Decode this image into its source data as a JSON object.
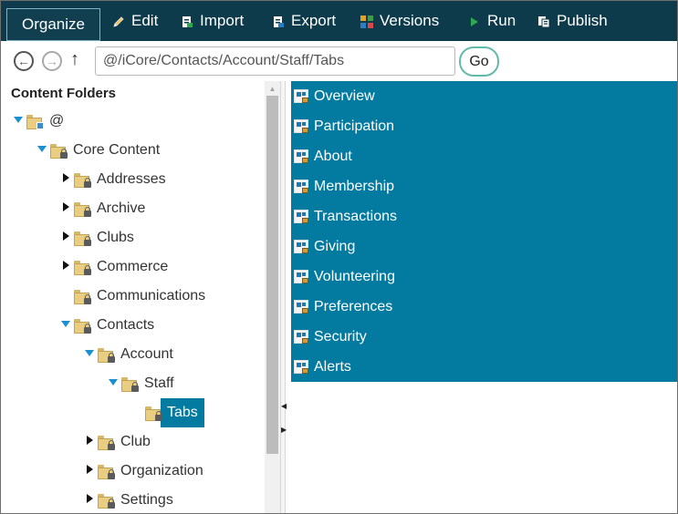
{
  "toolbar": {
    "buttons": [
      {
        "label": "Organize",
        "icon": "none"
      },
      {
        "label": "Edit",
        "icon": "pencil-icon"
      },
      {
        "label": "Import",
        "icon": "import-icon"
      },
      {
        "label": "Export",
        "icon": "export-icon"
      },
      {
        "label": "Versions",
        "icon": "versions-grid-icon"
      },
      {
        "label": "Run",
        "icon": "play-icon"
      },
      {
        "label": "Publish",
        "icon": "publish-icon"
      }
    ],
    "colors": {
      "background": "#0d3b4c",
      "run_icon": "#2fa84f",
      "versions_icon": [
        "#e0a32a",
        "#3d9b4a",
        "#2b7ec3",
        "#d84a4a"
      ]
    }
  },
  "address": {
    "path": "@/iCore/Contacts/Account/Staff/Tabs",
    "go_label": "Go"
  },
  "tree": {
    "title": "Content Folders",
    "items": [
      {
        "label": "@",
        "state": "open"
      },
      {
        "label": "Core Content",
        "state": "open"
      },
      {
        "label": "Addresses",
        "state": "closed"
      },
      {
        "label": "Archive",
        "state": "closed"
      },
      {
        "label": "Clubs",
        "state": "closed"
      },
      {
        "label": "Commerce",
        "state": "closed"
      },
      {
        "label": "Communications",
        "state": "none"
      },
      {
        "label": "Contacts",
        "state": "open"
      },
      {
        "label": "Account",
        "state": "open"
      },
      {
        "label": "Staff",
        "state": "open"
      },
      {
        "label": "Tabs",
        "state": "selected"
      },
      {
        "label": "Club",
        "state": "closed"
      },
      {
        "label": "Organization",
        "state": "closed"
      },
      {
        "label": "Settings",
        "state": "closed"
      }
    ]
  },
  "content": {
    "items": [
      {
        "label": "Overview"
      },
      {
        "label": "Participation"
      },
      {
        "label": "About"
      },
      {
        "label": "Membership"
      },
      {
        "label": "Transactions"
      },
      {
        "label": "Giving"
      },
      {
        "label": "Volunteering"
      },
      {
        "label": "Preferences"
      },
      {
        "label": "Security"
      },
      {
        "label": "Alerts"
      }
    ],
    "selection_color": "#037aa0"
  }
}
